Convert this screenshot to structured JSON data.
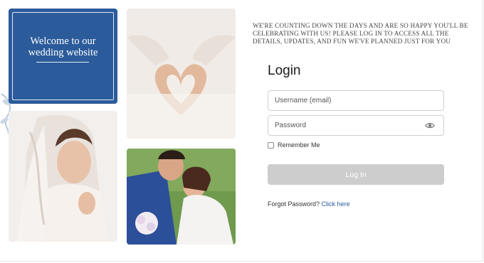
{
  "welcome": {
    "title_line1": "Welcome to our",
    "title_line2": "wedding website"
  },
  "intro": "WE'RE COUNTING DOWN THE DAYS AND ARE SO HAPPY YOU'LL BE CELEBRATING WITH US! PLEASE LOG IN TO ACCESS ALL THE DETAILS, UPDATES, AND FUN WE'VE PLANNED JUST FOR YOU",
  "login": {
    "heading": "Login",
    "username_placeholder": "Username (email)",
    "password_placeholder": "Password",
    "remember_label": "Remember Me",
    "submit_label": "Log In",
    "forgot_prefix": "Forgot Password?",
    "forgot_link": "Click here"
  },
  "colors": {
    "card_blue": "#2b5b9a",
    "button_disabled": "#cdcdcd",
    "link": "#2a5aa0"
  },
  "icons": [
    "leaf-icon",
    "eye-icon",
    "checkbox-icon"
  ]
}
